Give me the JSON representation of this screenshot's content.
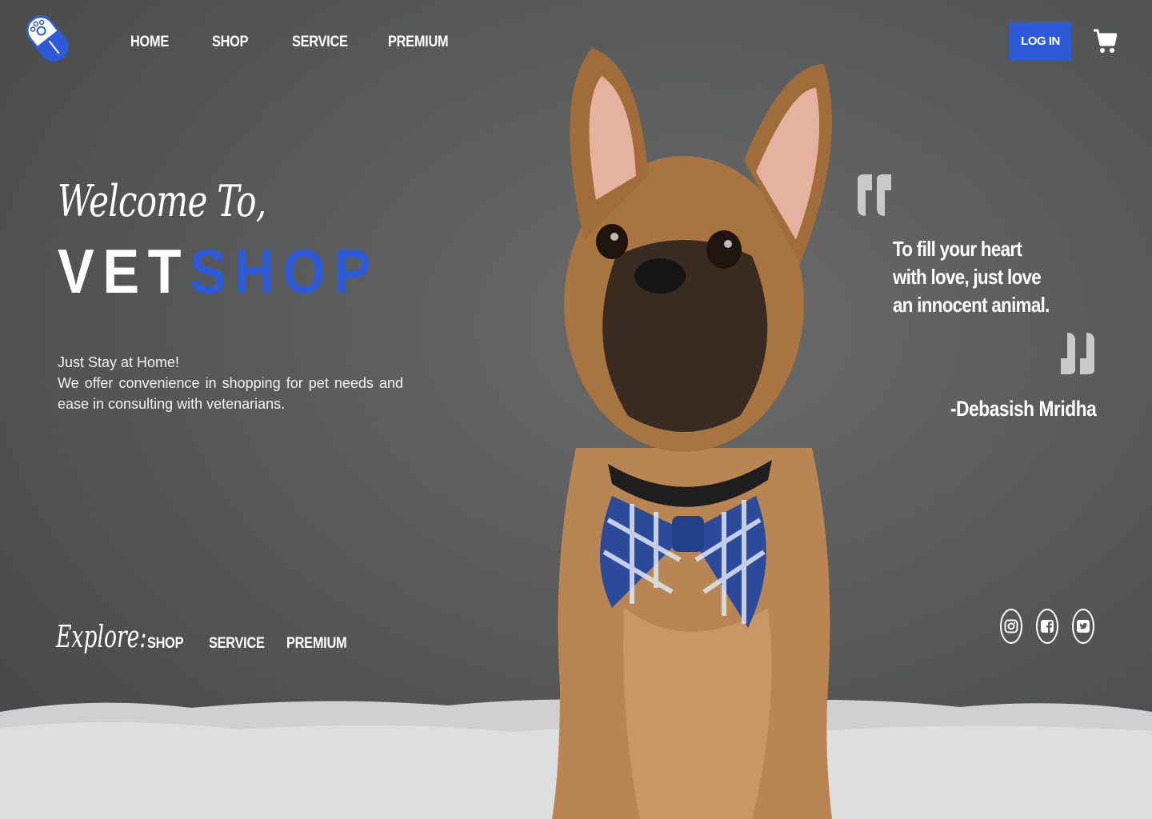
{
  "nav": {
    "items": [
      {
        "label": "HOME"
      },
      {
        "label": "SHOP"
      },
      {
        "label": "SERVICE"
      },
      {
        "label": "PREMIUM"
      }
    ],
    "login_label": "LOG IN",
    "icons": {
      "logo": "vet-logo-icon",
      "cart": "cart-icon"
    }
  },
  "hero": {
    "welcome": "Welcome To,",
    "brand_part1": "VET",
    "brand_part2": "SHOP",
    "tagline": [
      "Just Stay at Home!",
      "We offer convenience in shopping for pet needs and ease in consulting with vetenarians."
    ]
  },
  "explore": {
    "label": "Explore:",
    "links": [
      "SHOP",
      "SERVICE",
      "PREMIUM"
    ]
  },
  "quote": {
    "lines": [
      "To fill your heart",
      "with love, just love",
      "an innocent animal."
    ],
    "author": "-Debasish Mridha"
  },
  "social": {
    "icons": [
      "instagram-icon",
      "facebook-icon",
      "twitter-icon"
    ]
  },
  "colors": {
    "accent": "#2d5bd8",
    "background": "#585959",
    "text": "#ffffff"
  }
}
